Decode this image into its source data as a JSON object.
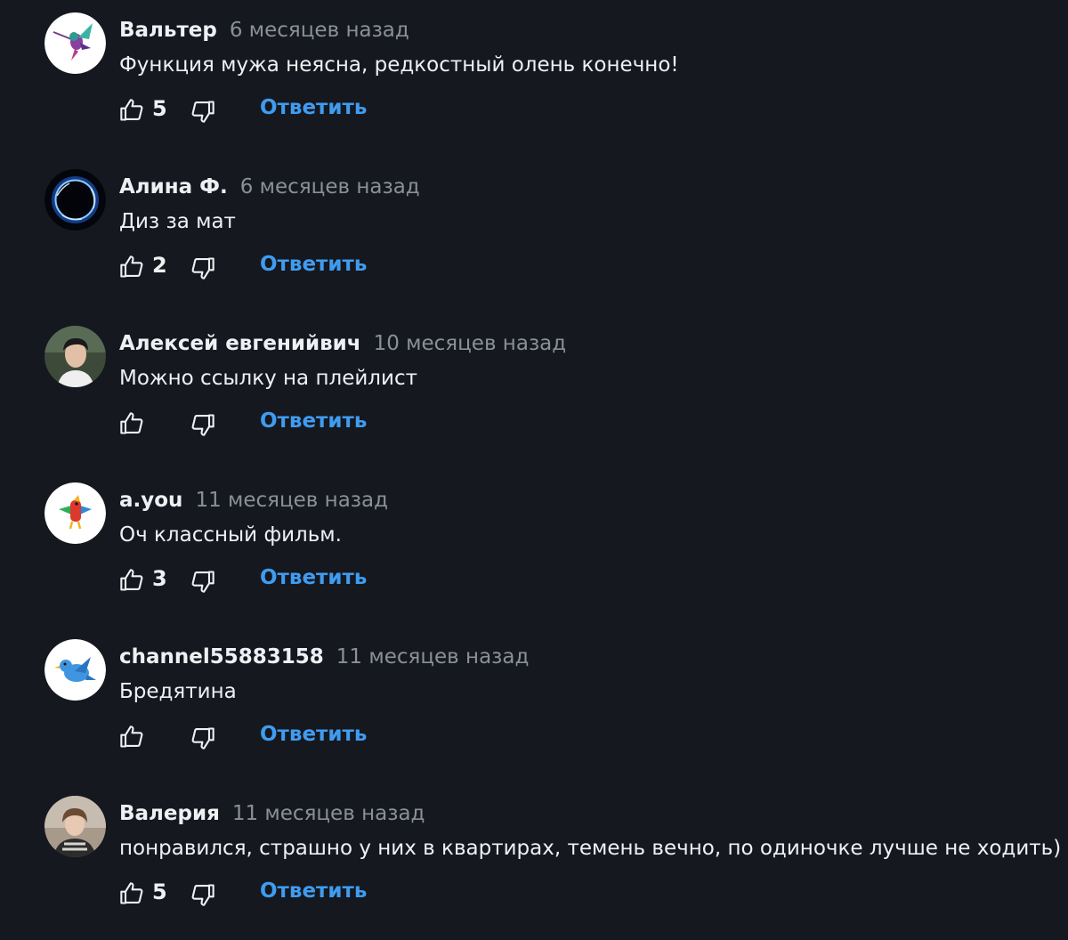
{
  "comments": [
    {
      "author": "Вальтер",
      "time": "6 месяцев назад",
      "text": "Функция мужа неясна, редкостный олень конечно!",
      "likes": "5",
      "reply_label": "Ответить",
      "avatar": "hummingbird-avatar"
    },
    {
      "author": "Алина Ф.",
      "time": "6 месяцев назад",
      "text": "Диз за мат",
      "likes": "2",
      "reply_label": "Ответить",
      "avatar": "energy-ring-avatar"
    },
    {
      "author": "Алексей евгенийвич",
      "time": "10 месяцев назад",
      "text": "Можно ссылку на плейлист",
      "likes": "",
      "reply_label": "Ответить",
      "avatar": "user-photo-avatar"
    },
    {
      "author": "a.you",
      "time": "11 месяцев назад",
      "text": "Оч классный фильм.",
      "likes": "3",
      "reply_label": "Ответить",
      "avatar": "parrot-avatar"
    },
    {
      "author": "channel55883158",
      "time": "11 месяцев назад",
      "text": "Бредятина",
      "likes": "",
      "reply_label": "Ответить",
      "avatar": "bluebird-avatar"
    },
    {
      "author": "Валерия",
      "time": "11 месяцев назад",
      "text": "понравился, страшно у них в квартирах, темень вечно, по одиночке лучше не ходить)",
      "likes": "5",
      "reply_label": "Ответить",
      "avatar": "user-photo-avatar"
    }
  ],
  "icons": {
    "like": "thumbs-up-icon",
    "dislike": "thumbs-down-icon"
  },
  "colors": {
    "background": "#15181f",
    "reply_link": "#3f9cf0",
    "timestamp": "#8a8f99"
  }
}
